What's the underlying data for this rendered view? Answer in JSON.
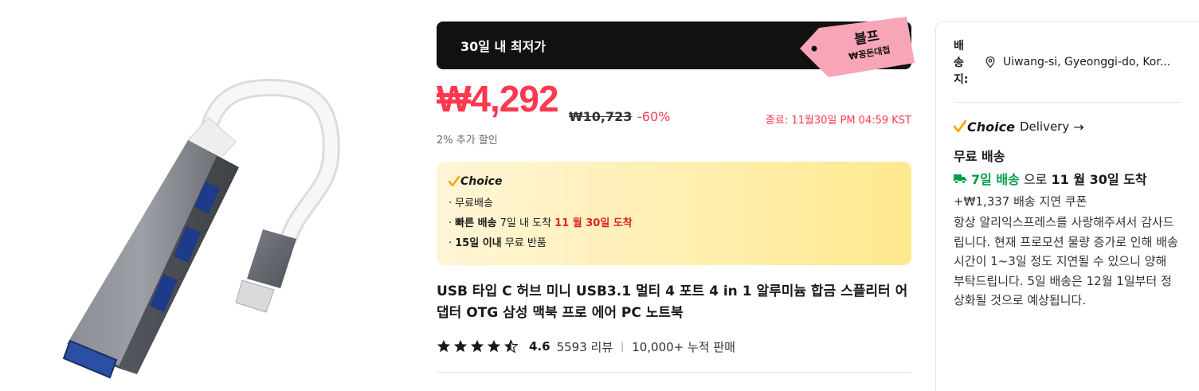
{
  "promo": {
    "text": "30일 내 최저가",
    "tag_line1": "블프",
    "tag_line2": "₩꽁돈대첩"
  },
  "price": {
    "current": "₩4,292",
    "original": "₩10,723",
    "discount": "-60%",
    "end_time": "종료: 11월30일 PM 04:59 KST",
    "extra_discount": "2% 추가 할인"
  },
  "choice_box": {
    "logo": "Choice",
    "items": [
      {
        "dot": "·",
        "text": "무료배송"
      },
      {
        "dot": "·",
        "part1": "빠른 배송",
        "part2": " 7일 내 도착 ",
        "part3": "11 월 30일 도착"
      },
      {
        "dot": "·",
        "part1": "15일 이내",
        "part2": "  무료 반품"
      }
    ]
  },
  "product": {
    "title": "USB 타입 C 허브 미니 USB3.1 멀티 4 포트 4 in 1 알루미늄 합금 스플리터 어댑터 OTG 삼성 맥북 프로 에어 PC 노트북",
    "rating": 4.6,
    "rating_text": "4.6",
    "reviews": "5593 리뷰",
    "separator": "|",
    "sold": "10,000+ 누적 판매"
  },
  "shipping": {
    "label": "배송지:",
    "label_chars": [
      "배",
      "송",
      "지:"
    ],
    "location": "Uiwang-si, Gyeonggi-do, Kor...",
    "choice_logo": "Choice",
    "choice_suffix": "Delivery",
    "arrow": "→",
    "free_shipping": "무료 배송",
    "delivery_days": "7일 배송",
    "delivery_mid": " 으로 ",
    "delivery_date": "11 월 30일 도착",
    "coupon": "+₩1,337 배송 지연 쿠폰",
    "notice": "항상 알리익스프레스를 사랑해주셔서 감사드립니다. 현재 프로모션 물량 증가로 인해 배송 시간이 1~3일 정도 지연될 수 있으니 양해 부탁드립니다. 5일 배송은 12월 1일부터 정상화될 것으로 예상됩니다."
  },
  "colors": {
    "price_red": "#fd384f",
    "choice_orange": "#f7a600",
    "delivery_green": "#00a046",
    "promo_pink": "#f8a5b8"
  }
}
